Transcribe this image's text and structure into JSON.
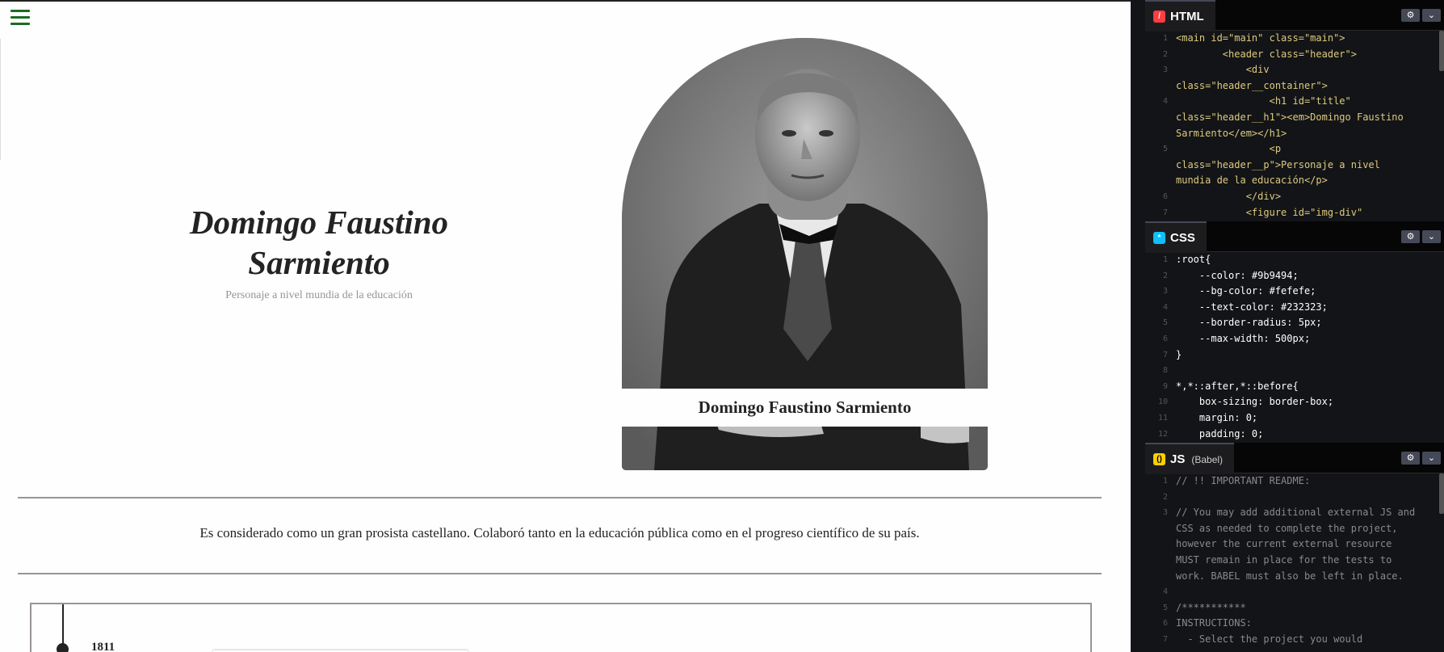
{
  "preview": {
    "menu_icon": "hamburger-icon",
    "title": "Domingo Faustino Sarmiento",
    "subtitle": "Personaje a nivel mundia de la educación",
    "figcaption": "Domingo Faustino Sarmiento",
    "description": "Es considerado como un gran prosista castellano. Colaboró tanto en la educación pública como en el progreso científico de su país.",
    "timeline": [
      {
        "year": "1811"
      }
    ]
  },
  "editor": {
    "gear_icon": "gear-icon",
    "chevron_icon": "chevron-down-icon",
    "html": {
      "tab_label": "HTML",
      "badge": "/",
      "lines": [
        {
          "n": "1",
          "code": "<main id=\"main\" class=\"main\">"
        },
        {
          "n": "2",
          "code": "        <header class=\"header\">"
        },
        {
          "n": "3",
          "code": "            <div"
        },
        {
          "n": "",
          "code": "class=\"header__container\">"
        },
        {
          "n": "4",
          "code": "                <h1 id=\"title\""
        },
        {
          "n": "",
          "code": "class=\"header__h1\"><em>Domingo Faustino"
        },
        {
          "n": "",
          "code": "Sarmiento</em></h1>"
        },
        {
          "n": "5",
          "code": "                <p"
        },
        {
          "n": "",
          "code": "class=\"header__p\">Personaje a nivel"
        },
        {
          "n": "",
          "code": "mundia de la educación</p>"
        },
        {
          "n": "6",
          "code": "            </div>"
        },
        {
          "n": "7",
          "code": "            <figure id=\"img-div\""
        }
      ]
    },
    "css": {
      "tab_label": "CSS",
      "badge": "*",
      "lines": [
        {
          "n": "1",
          "code": ":root{"
        },
        {
          "n": "2",
          "code": "    --color: #9b9494;"
        },
        {
          "n": "3",
          "code": "    --bg-color: #fefefe;"
        },
        {
          "n": "4",
          "code": "    --text-color: #232323;"
        },
        {
          "n": "5",
          "code": "    --border-radius: 5px;"
        },
        {
          "n": "6",
          "code": "    --max-width: 500px;"
        },
        {
          "n": "7",
          "code": "}"
        },
        {
          "n": "8",
          "code": ""
        },
        {
          "n": "9",
          "code": "*,*::after,*::before{"
        },
        {
          "n": "10",
          "code": "    box-sizing: border-box;"
        },
        {
          "n": "11",
          "code": "    margin: 0;"
        },
        {
          "n": "12",
          "code": "    padding: 0;"
        }
      ]
    },
    "js": {
      "tab_label": "JS",
      "tab_sub": "(Babel)",
      "badge": "()",
      "lines": [
        {
          "n": "1",
          "code": "// !! IMPORTANT README:"
        },
        {
          "n": "2",
          "code": ""
        },
        {
          "n": "3",
          "code": "// You may add additional external JS and"
        },
        {
          "n": "",
          "code": "CSS as needed to complete the project,"
        },
        {
          "n": "",
          "code": "however the current external resource"
        },
        {
          "n": "",
          "code": "MUST remain in place for the tests to"
        },
        {
          "n": "",
          "code": "work. BABEL must also be left in place."
        },
        {
          "n": "4",
          "code": ""
        },
        {
          "n": "5",
          "code": "/***********"
        },
        {
          "n": "6",
          "code": "INSTRUCTIONS:"
        },
        {
          "n": "7",
          "code": "  - Select the project you would"
        }
      ]
    }
  },
  "colors": {
    "accent_green": "#1d6b22",
    "text": "#232323",
    "muted": "#9b9494",
    "editor_bg": "#131417"
  }
}
